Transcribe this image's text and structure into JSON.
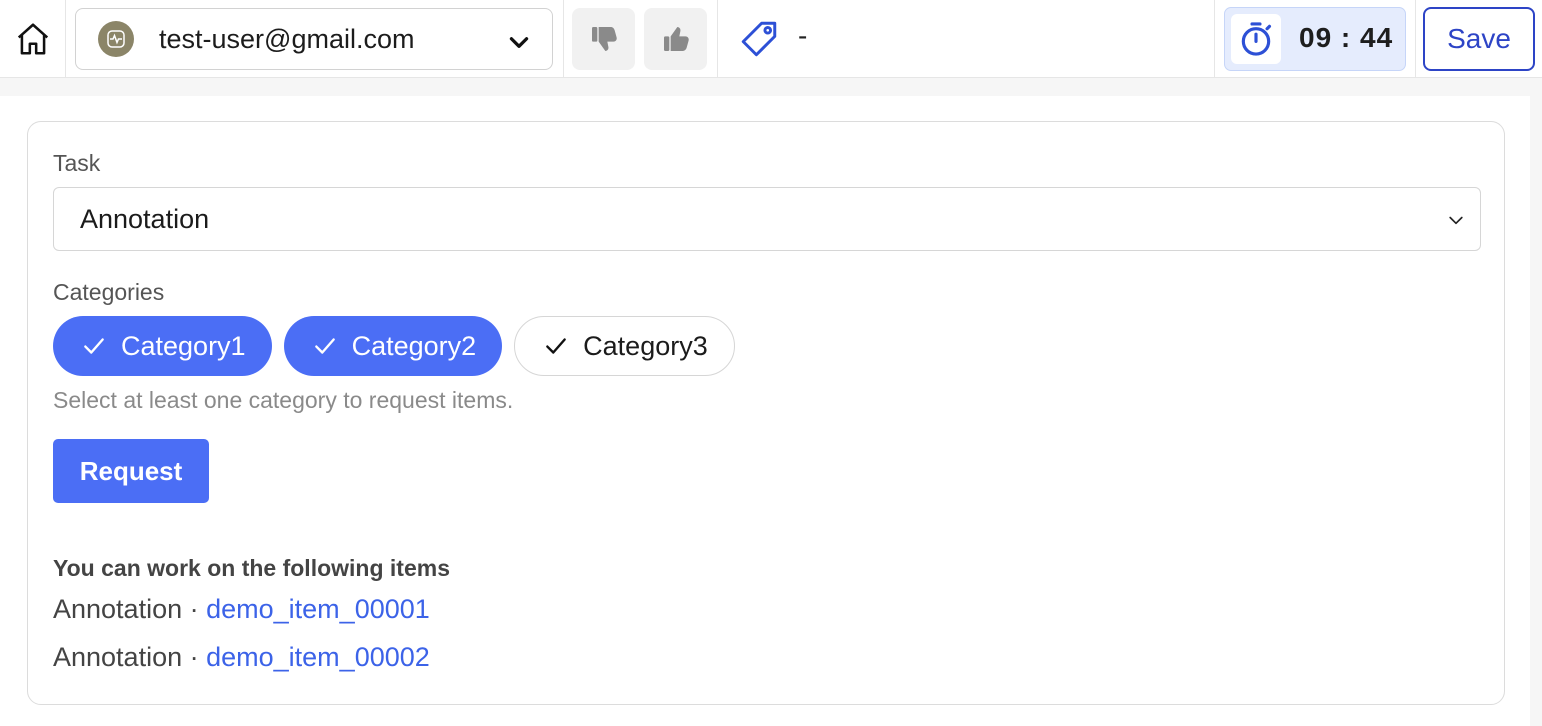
{
  "header": {
    "user_email": "test-user@gmail.com",
    "tag_value": "-",
    "timer": "09 : 44",
    "save_label": "Save"
  },
  "form": {
    "task_label": "Task",
    "task_value": "Annotation",
    "categories_label": "Categories",
    "categories": [
      {
        "label": "Category1",
        "selected": true
      },
      {
        "label": "Category2",
        "selected": true
      },
      {
        "label": "Category3",
        "selected": false
      }
    ],
    "hint": "Select at least one category to request items.",
    "request_label": "Request"
  },
  "items": {
    "title": "You can work on the following items",
    "list": [
      {
        "task": "Annotation",
        "separator": " · ",
        "id": "demo_item_00001"
      },
      {
        "task": "Annotation",
        "separator": " · ",
        "id": "demo_item_00002"
      }
    ]
  },
  "colors": {
    "accent": "#4b6ef5",
    "save_border": "#2d44c6",
    "timer_bg": "#e5ecfd",
    "link": "#3c63e8"
  }
}
